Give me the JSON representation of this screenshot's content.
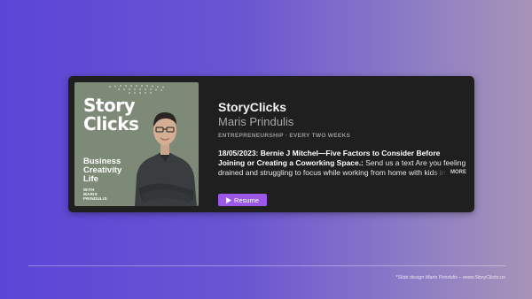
{
  "podcast": {
    "title": "StoryClicks",
    "author": "Maris Prindulis",
    "category": "ENTREPRENEURSHIP · EVERY TWO WEEKS",
    "episode_title": "18/05/2023: Bernie J Mitchel—Five Factors to Consider Before Joining or Creating a Coworking Space.:",
    "episode_description": " Send us a text  Are you feeling drained and struggling to focus while working from home with kids in tow? You're not alone",
    "more_label": "MORE",
    "resume_label": "Resume",
    "resume_icon": "play-icon"
  },
  "cover": {
    "title_line1": "Story",
    "title_line2": "Clicks",
    "sub_line1": "Business",
    "sub_line2": "Creativity",
    "sub_line3": "Life",
    "with_line1": "WITH",
    "with_line2": "MARIS",
    "with_line3": "PRINDULIS",
    "bg_color": "#7e8a78"
  },
  "footer": {
    "credit": "*Slide design Maris Prindulis – www.StoryClicks.us"
  },
  "colors": {
    "accent": "#9b57e6",
    "card_bg": "#1f1f1f"
  }
}
